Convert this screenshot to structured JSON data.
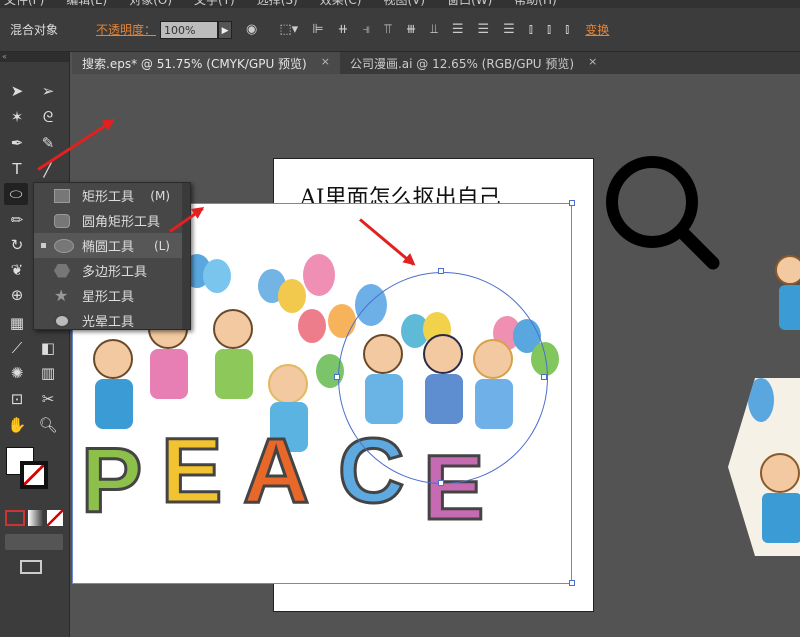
{
  "menu": [
    "文件(F)",
    "编辑(E)",
    "对象(O)",
    "文字(T)",
    "选择(S)",
    "效果(C)",
    "视图(V)",
    "窗口(W)",
    "帮助(H)"
  ],
  "control": {
    "selection": "混合对象",
    "opacity_label": "不透明度：",
    "opacity_value": "100%",
    "transform_label": "变换"
  },
  "tabs": [
    {
      "label": "搜索.eps* @ 51.75% (CMYK/GPU 预览)",
      "close": "×",
      "active": true
    },
    {
      "label": "公司漫画.ai @ 12.65% (RGB/GPU 预览)",
      "close": "×",
      "active": false
    }
  ],
  "flyout": [
    {
      "label": "矩形工具",
      "shortcut": "(M)"
    },
    {
      "label": "圆角矩形工具",
      "shortcut": ""
    },
    {
      "label": "椭圆工具",
      "shortcut": "(L)",
      "selected": true
    },
    {
      "label": "多边形工具",
      "shortcut": ""
    },
    {
      "label": "星形工具",
      "shortcut": ""
    },
    {
      "label": "光晕工具",
      "shortcut": ""
    }
  ],
  "artboard": {
    "title": "AI里面怎么抠出自己"
  },
  "artwork": {
    "letters": [
      "P",
      "E",
      "A",
      "C",
      "E"
    ]
  },
  "colors": {
    "accent": "#e0843a",
    "arrow": "#e32020",
    "selection": "#4a6fd0"
  }
}
